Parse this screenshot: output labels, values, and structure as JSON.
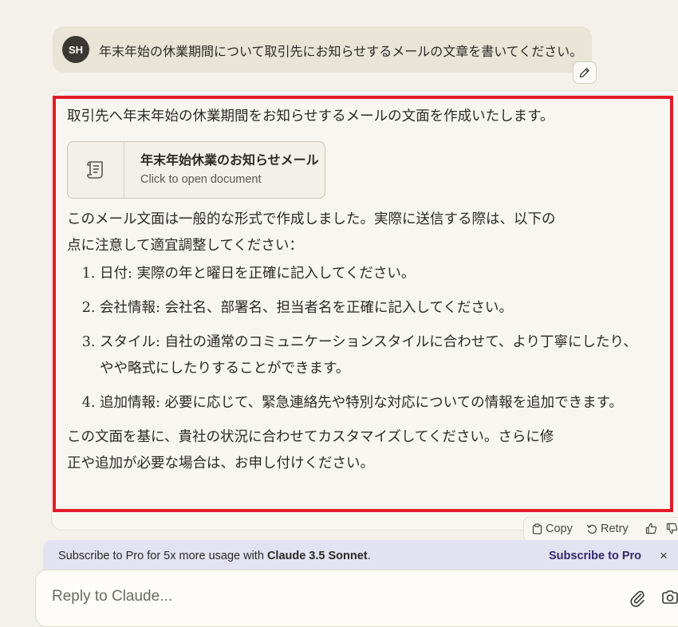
{
  "user_message": {
    "avatar_initials": "SH",
    "text": "年末年始の休業期間について取引先にお知らせするメールの文章を書いてください。"
  },
  "response": {
    "intro": "取引先へ年末年始の休業期間をお知らせするメールの文面を作成いたします。",
    "artifact": {
      "title": "年末年始休業のお知らせメール",
      "subtitle": "Click to open document",
      "icon": "document-scroll-icon"
    },
    "body_line1": "このメール文面は一般的な形式で作成しました。実際に送信する際は、以下の",
    "body_line2": "点に注意して適宜調整してください：",
    "notes": [
      {
        "term": "日付:",
        "text": "実際の年と曜日を正確に記入してください。"
      },
      {
        "term": "会社情報:",
        "text": "会社名、部署名、担当者名を正確に記入してください。"
      },
      {
        "term": "スタイル:",
        "text": "自社の通常のコミュニケーションスタイルに合わせて、より丁寧にしたり、やや略式にしたりすることができます。"
      },
      {
        "term": "追加情報:",
        "text": "必要に応じて、緊急連絡先や特別な対応についての情報を追加できます。"
      }
    ],
    "closing_line1": "この文面を基に、貴社の状況に合わせてカスタマイズしてください。さらに修",
    "closing_line2": "正や追加が必要な場合は、お申し付けください。"
  },
  "actions": {
    "copy": "Copy",
    "retry": "Retry"
  },
  "subscribe": {
    "text_prefix": "Subscribe to Pro for 5x more usage with ",
    "model": "Claude 3.5 Sonnet",
    "text_suffix": ".",
    "link": "Subscribe to Pro",
    "close": "×"
  },
  "composer": {
    "placeholder": "Reply to Claude..."
  },
  "colors": {
    "highlight": "#e21c2a",
    "subscribe_bg": "#e3e2f0",
    "subscribe_link": "#2f2b6b",
    "page_bg": "#f3f1ea"
  }
}
